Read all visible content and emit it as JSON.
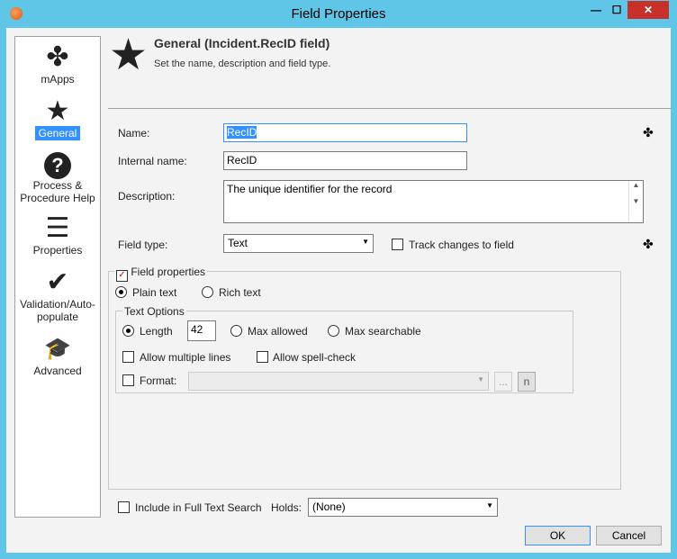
{
  "window": {
    "title": "Field Properties",
    "minimize": "—",
    "maximize": "☐",
    "close": "✕"
  },
  "sidebar": {
    "items": [
      {
        "label": "mApps",
        "icon": "puzzle-icon"
      },
      {
        "label": "General",
        "icon": "star-icon"
      },
      {
        "label": "Process & Procedure Help",
        "icon": "help-icon"
      },
      {
        "label": "Properties",
        "icon": "list-icon"
      },
      {
        "label": "Validation/Auto-populate",
        "icon": "checklist-icon"
      },
      {
        "label": "Advanced",
        "icon": "graduation-cap-icon"
      }
    ],
    "selected": "General"
  },
  "header": {
    "title": "General (Incident.RecID field)",
    "subtitle": "Set the name, description and field type."
  },
  "form": {
    "name_label": "Name:",
    "name_value": "RecID",
    "internal_label": "Internal name:",
    "internal_value": "RecID",
    "description_label": "Description:",
    "description_value": "The unique identifier for the record",
    "fieldtype_label": "Field type:",
    "fieldtype_value": "Text",
    "track_label": "Track changes to field",
    "track_checked": false
  },
  "field_properties": {
    "label": "Field properties",
    "checked": true,
    "plain_text": "Plain text",
    "rich_text": "Rich text",
    "selected": "Plain text",
    "text_options": {
      "label": "Text Options",
      "length_label": "Length",
      "length_value": "42",
      "max_allowed": "Max allowed",
      "max_searchable": "Max searchable",
      "multi_lines": "Allow multiple lines",
      "spell_check": "Allow spell-check",
      "format_label": "Format:",
      "format_value": "",
      "ellipsis": "...",
      "n_button": "n"
    }
  },
  "footer": {
    "fulltext_label": "Include in Full Text Search",
    "holds_label": "Holds:",
    "holds_value": "(None)",
    "ok": "OK",
    "cancel": "Cancel"
  }
}
